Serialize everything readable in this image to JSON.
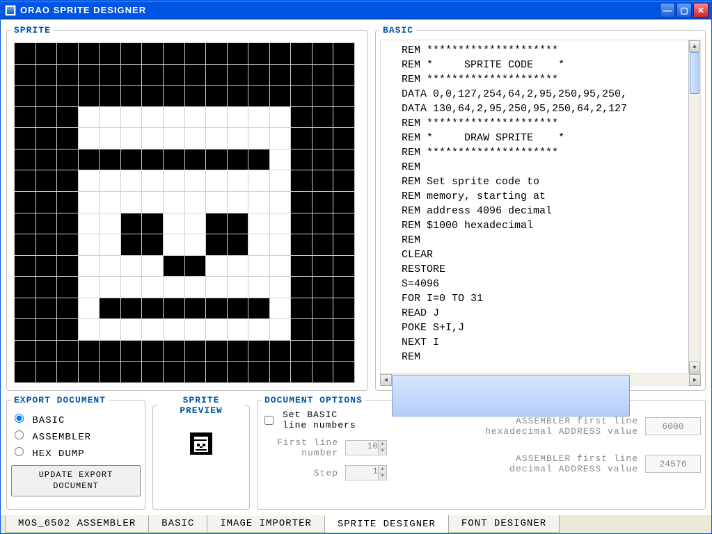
{
  "titlebar": {
    "title": "ORAO  SPRITE  DESIGNER"
  },
  "panels": {
    "sprite_legend": "SPRITE",
    "basic_legend": "BASIC",
    "export_legend": "EXPORT DOCUMENT",
    "preview_legend": "SPRITE PREVIEW",
    "options_legend": "DOCUMENT OPTIONS"
  },
  "sprite_grid": [
    "1111111111111111",
    "1111111111111111",
    "1111111111111111",
    "1110000000000111",
    "1110000000000111",
    "1111111111110111",
    "1110000000000111",
    "1110000000000111",
    "1110011001100111",
    "1110011001100111",
    "1110000110000111",
    "1110000000000111",
    "1110111111110111",
    "1110000000000111",
    "1111111111111111",
    "1111111111111111"
  ],
  "basic_code": "REM *********************\nREM *     SPRITE CODE    *\nREM *********************\nDATA 0,0,127,254,64,2,95,250,95,250,\nDATA 130,64,2,95,250,95,250,64,2,127\nREM *********************\nREM *     DRAW SPRITE    *\nREM *********************\nREM\nREM Set sprite code to\nREM memory, starting at\nREM address 4096 decimal\nREM $1000 hexadecimal\nREM\nCLEAR\nRESTORE\nS=4096\nFOR I=0 TO 31\nREAD J\nPOKE S+I,J\nNEXT I\nREM",
  "export": {
    "opt_basic": "BASIC",
    "opt_assembler": "ASSEMBLER",
    "opt_hexdump": "HEX DUMP",
    "update_btn": "UPDATE EXPORT\nDOCUMENT"
  },
  "options": {
    "set_line_numbers": "Set BASIC\nline numbers",
    "first_line_label": "First line\nnumber",
    "first_line_value": "10",
    "step_label": "Step",
    "step_value": "1",
    "asm_hex_label": "ASSEMBLER first line\nhexadecimal ADDRESS value",
    "asm_hex_value": "6000",
    "asm_dec_label": "ASSEMBLER first line\ndecimal ADDRESS value",
    "asm_dec_value": "24576"
  },
  "tabs": [
    {
      "label": "MOS_6502 ASSEMBLER",
      "active": false
    },
    {
      "label": "BASIC",
      "active": false
    },
    {
      "label": "IMAGE IMPORTER",
      "active": false
    },
    {
      "label": "SPRITE DESIGNER",
      "active": true
    },
    {
      "label": "FONT DESIGNER",
      "active": false
    }
  ]
}
